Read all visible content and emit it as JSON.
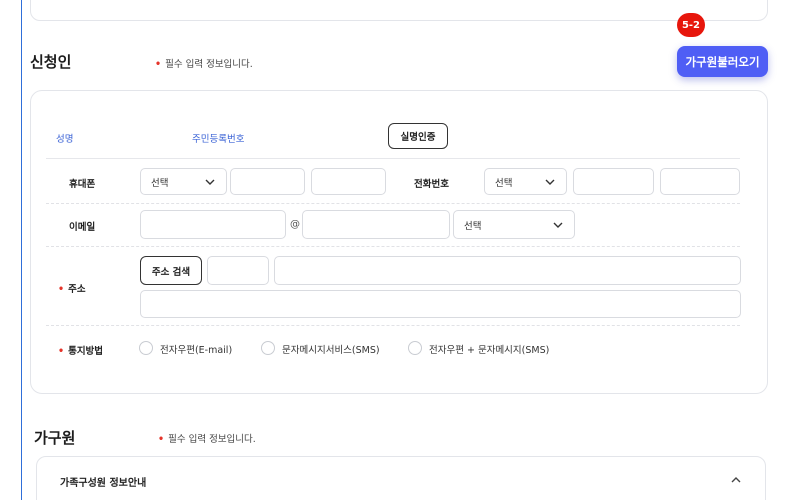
{
  "applicant": {
    "title": "신청인",
    "required_note": "필수 입력 정보입니다.",
    "load_button": "가구원불러오기",
    "step_badge": "5-2",
    "name_label": "성명",
    "rrn_label": "주민등록번호",
    "verify_button": "실명인증",
    "mobile_label": "휴대폰",
    "mobile_select": "선택",
    "phone_label": "전화번호",
    "phone_select": "선택",
    "email_label": "이메일",
    "email_at": "@",
    "email_domain_select": "선택",
    "address_label": "주소",
    "address_search_button": "주소 검색",
    "notify_label": "통지방법",
    "notify_options": [
      {
        "label": "전자우편(E-mail)"
      },
      {
        "label": "문자메시지서비스(SMS)"
      },
      {
        "label": "전자우편 + 문자메시지(SMS)"
      }
    ]
  },
  "family": {
    "title": "가구원",
    "required_note": "필수 입력 정보입니다.",
    "info_title": "가족구성원 정보안내"
  },
  "colors": {
    "accent": "#4f5ef5",
    "badge": "#e7160c",
    "required_dot": "#e5342a",
    "label_blue": "#3b63d6"
  }
}
